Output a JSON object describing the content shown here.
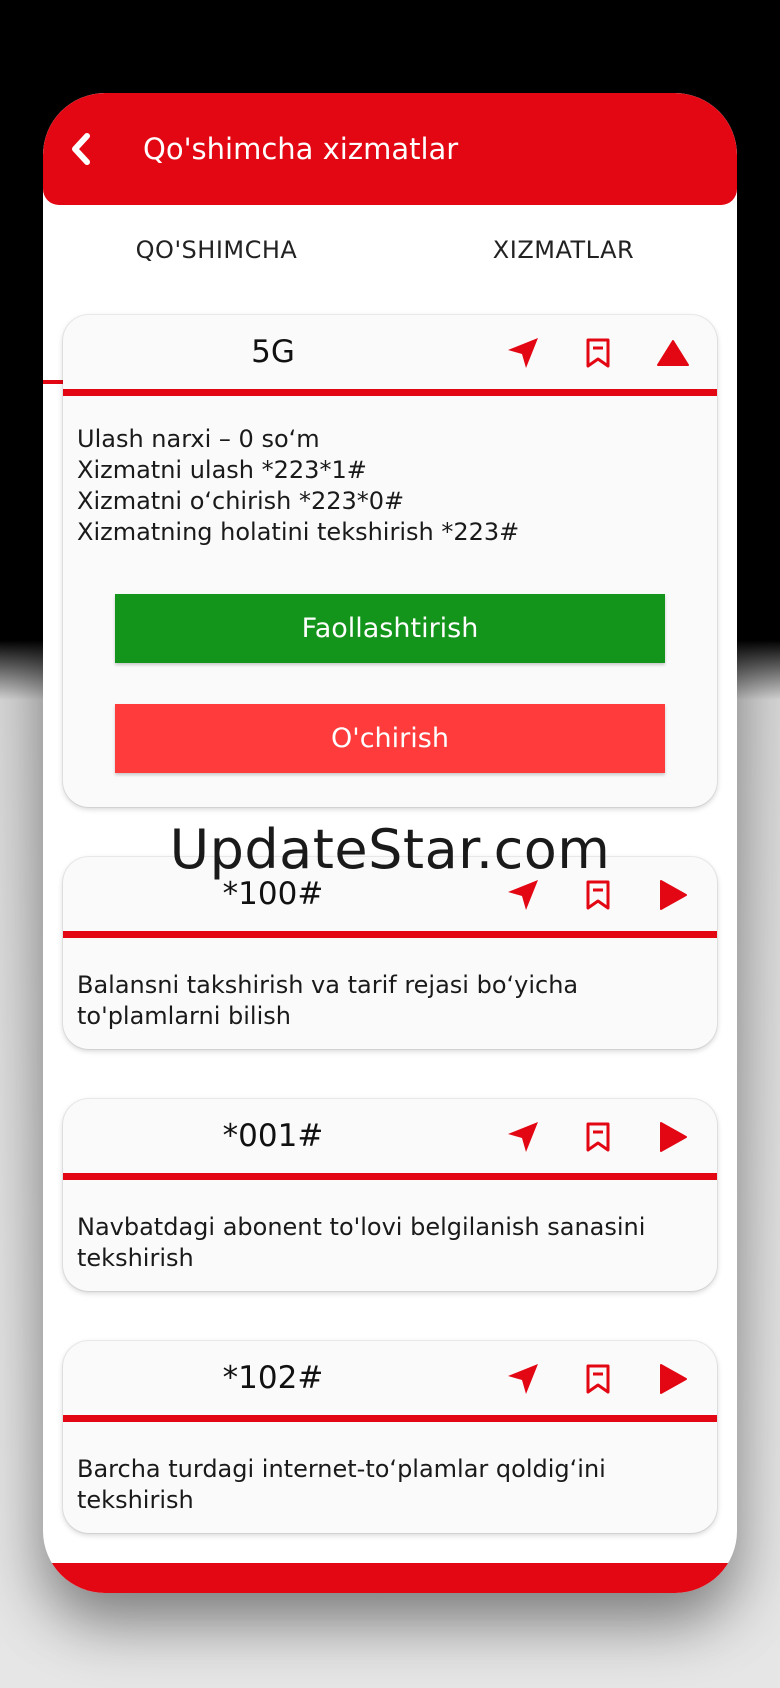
{
  "header": {
    "title": "Qo'shimcha xizmatlar",
    "back_icon": "chevron-left-icon"
  },
  "tabs": [
    {
      "label": "QO'SHIMCHA",
      "active": true
    },
    {
      "label": "XIZMATLAR",
      "active": false
    }
  ],
  "cards": [
    {
      "code": "5G",
      "lines": [
        "Ulash narxi – 0 so‘m",
        "Xizmatni ulash *223*1#",
        "Xizmatni o‘chirish *223*0#",
        "Xizmatning holatini tekshirish *223#"
      ],
      "activate_label": "Faollashtirish",
      "deactivate_label": "O'chirish",
      "expanded": true
    },
    {
      "code": "*100#",
      "description": "Balansni takshirish va tarif rejasi bo‘yicha to'plamlarni bilish"
    },
    {
      "code": "*001#",
      "description": "Navbatdagi abonent to'lovi belgilanish sanasini tekshirish"
    },
    {
      "code": "*102#",
      "description": "Barcha turdagi internet-to‘plamlar qoldig‘ini tekshirish"
    }
  ],
  "watermark": "UpdateStar.com",
  "colors": {
    "brand_red": "#e30613",
    "activate_green": "#13941a",
    "deactivate_red": "#ff3b3b"
  }
}
